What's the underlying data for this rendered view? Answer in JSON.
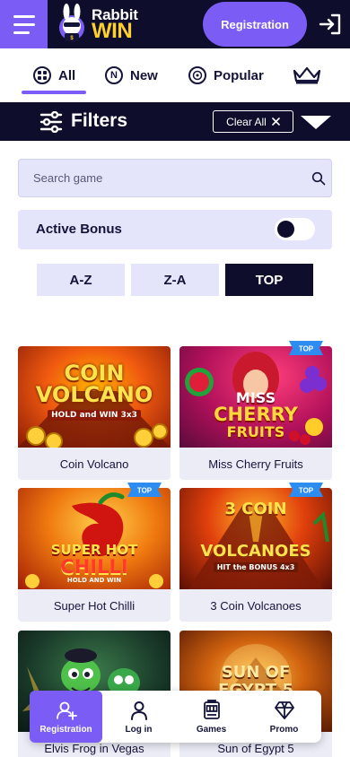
{
  "header": {
    "logo_line1": "Rabbit",
    "logo_line2": "WIN",
    "registration_label": "Registration",
    "menu_icon": "hamburger-icon",
    "login_icon": "login-arrow-icon"
  },
  "tabs": [
    {
      "label": "All",
      "icon": "grid-icon",
      "active": true
    },
    {
      "label": "New",
      "icon": "new-badge-icon"
    },
    {
      "label": "Popular",
      "icon": "roulette-icon"
    },
    {
      "label": "",
      "icon": "crown-icon"
    }
  ],
  "filters": {
    "title": "Filters",
    "clear_label": "Clear All",
    "search_placeholder": "Search game",
    "active_bonus_label": "Active Bonus",
    "active_bonus_on": false,
    "sort": {
      "az": "A-Z",
      "za": "Z-A",
      "top": "TOP",
      "selected": "TOP"
    }
  },
  "games": [
    {
      "name": "Coin Volcano",
      "art_line1": "COIN",
      "art_line2": "VOLCANO",
      "art_sub": "HOLD and WIN 3x3",
      "top": false
    },
    {
      "name": "Miss Cherry Fruits",
      "art_line1": "MISS",
      "art_line2": "CHERRY",
      "art_sub": "FRUITS",
      "top": true
    },
    {
      "name": "Super Hot Chilli",
      "art_line1": "SUPER HOT",
      "art_line2": "CHILLI",
      "art_sub": "HOLD AND WIN",
      "top": true
    },
    {
      "name": "3 Coin Volcanoes",
      "art_line1": "3 COIN",
      "art_line2": "VOLCANOES",
      "art_sub": "HIT the BONUS 4x3",
      "top": true
    },
    {
      "name": "Elvis Frog in Vegas",
      "art_line1": "",
      "art_line2": "",
      "art_sub": "",
      "top": false
    },
    {
      "name": "Sun of Egypt 5",
      "art_line1": "SUN OF",
      "art_line2": "EGYPT 5",
      "art_sub": "",
      "top": false
    }
  ],
  "top_badge_label": "TOP",
  "bottom_nav": [
    {
      "label": "Registration",
      "icon": "add-user-icon",
      "active": true
    },
    {
      "label": "Log in",
      "icon": "user-icon"
    },
    {
      "label": "Games",
      "icon": "slot-machine-icon"
    },
    {
      "label": "Promo",
      "icon": "diamond-icon"
    }
  ],
  "colors": {
    "accent": "#7b5cf5",
    "dark": "#0e0e2c",
    "panel": "#e4e4fb",
    "brand_yellow": "#ffd02a"
  }
}
